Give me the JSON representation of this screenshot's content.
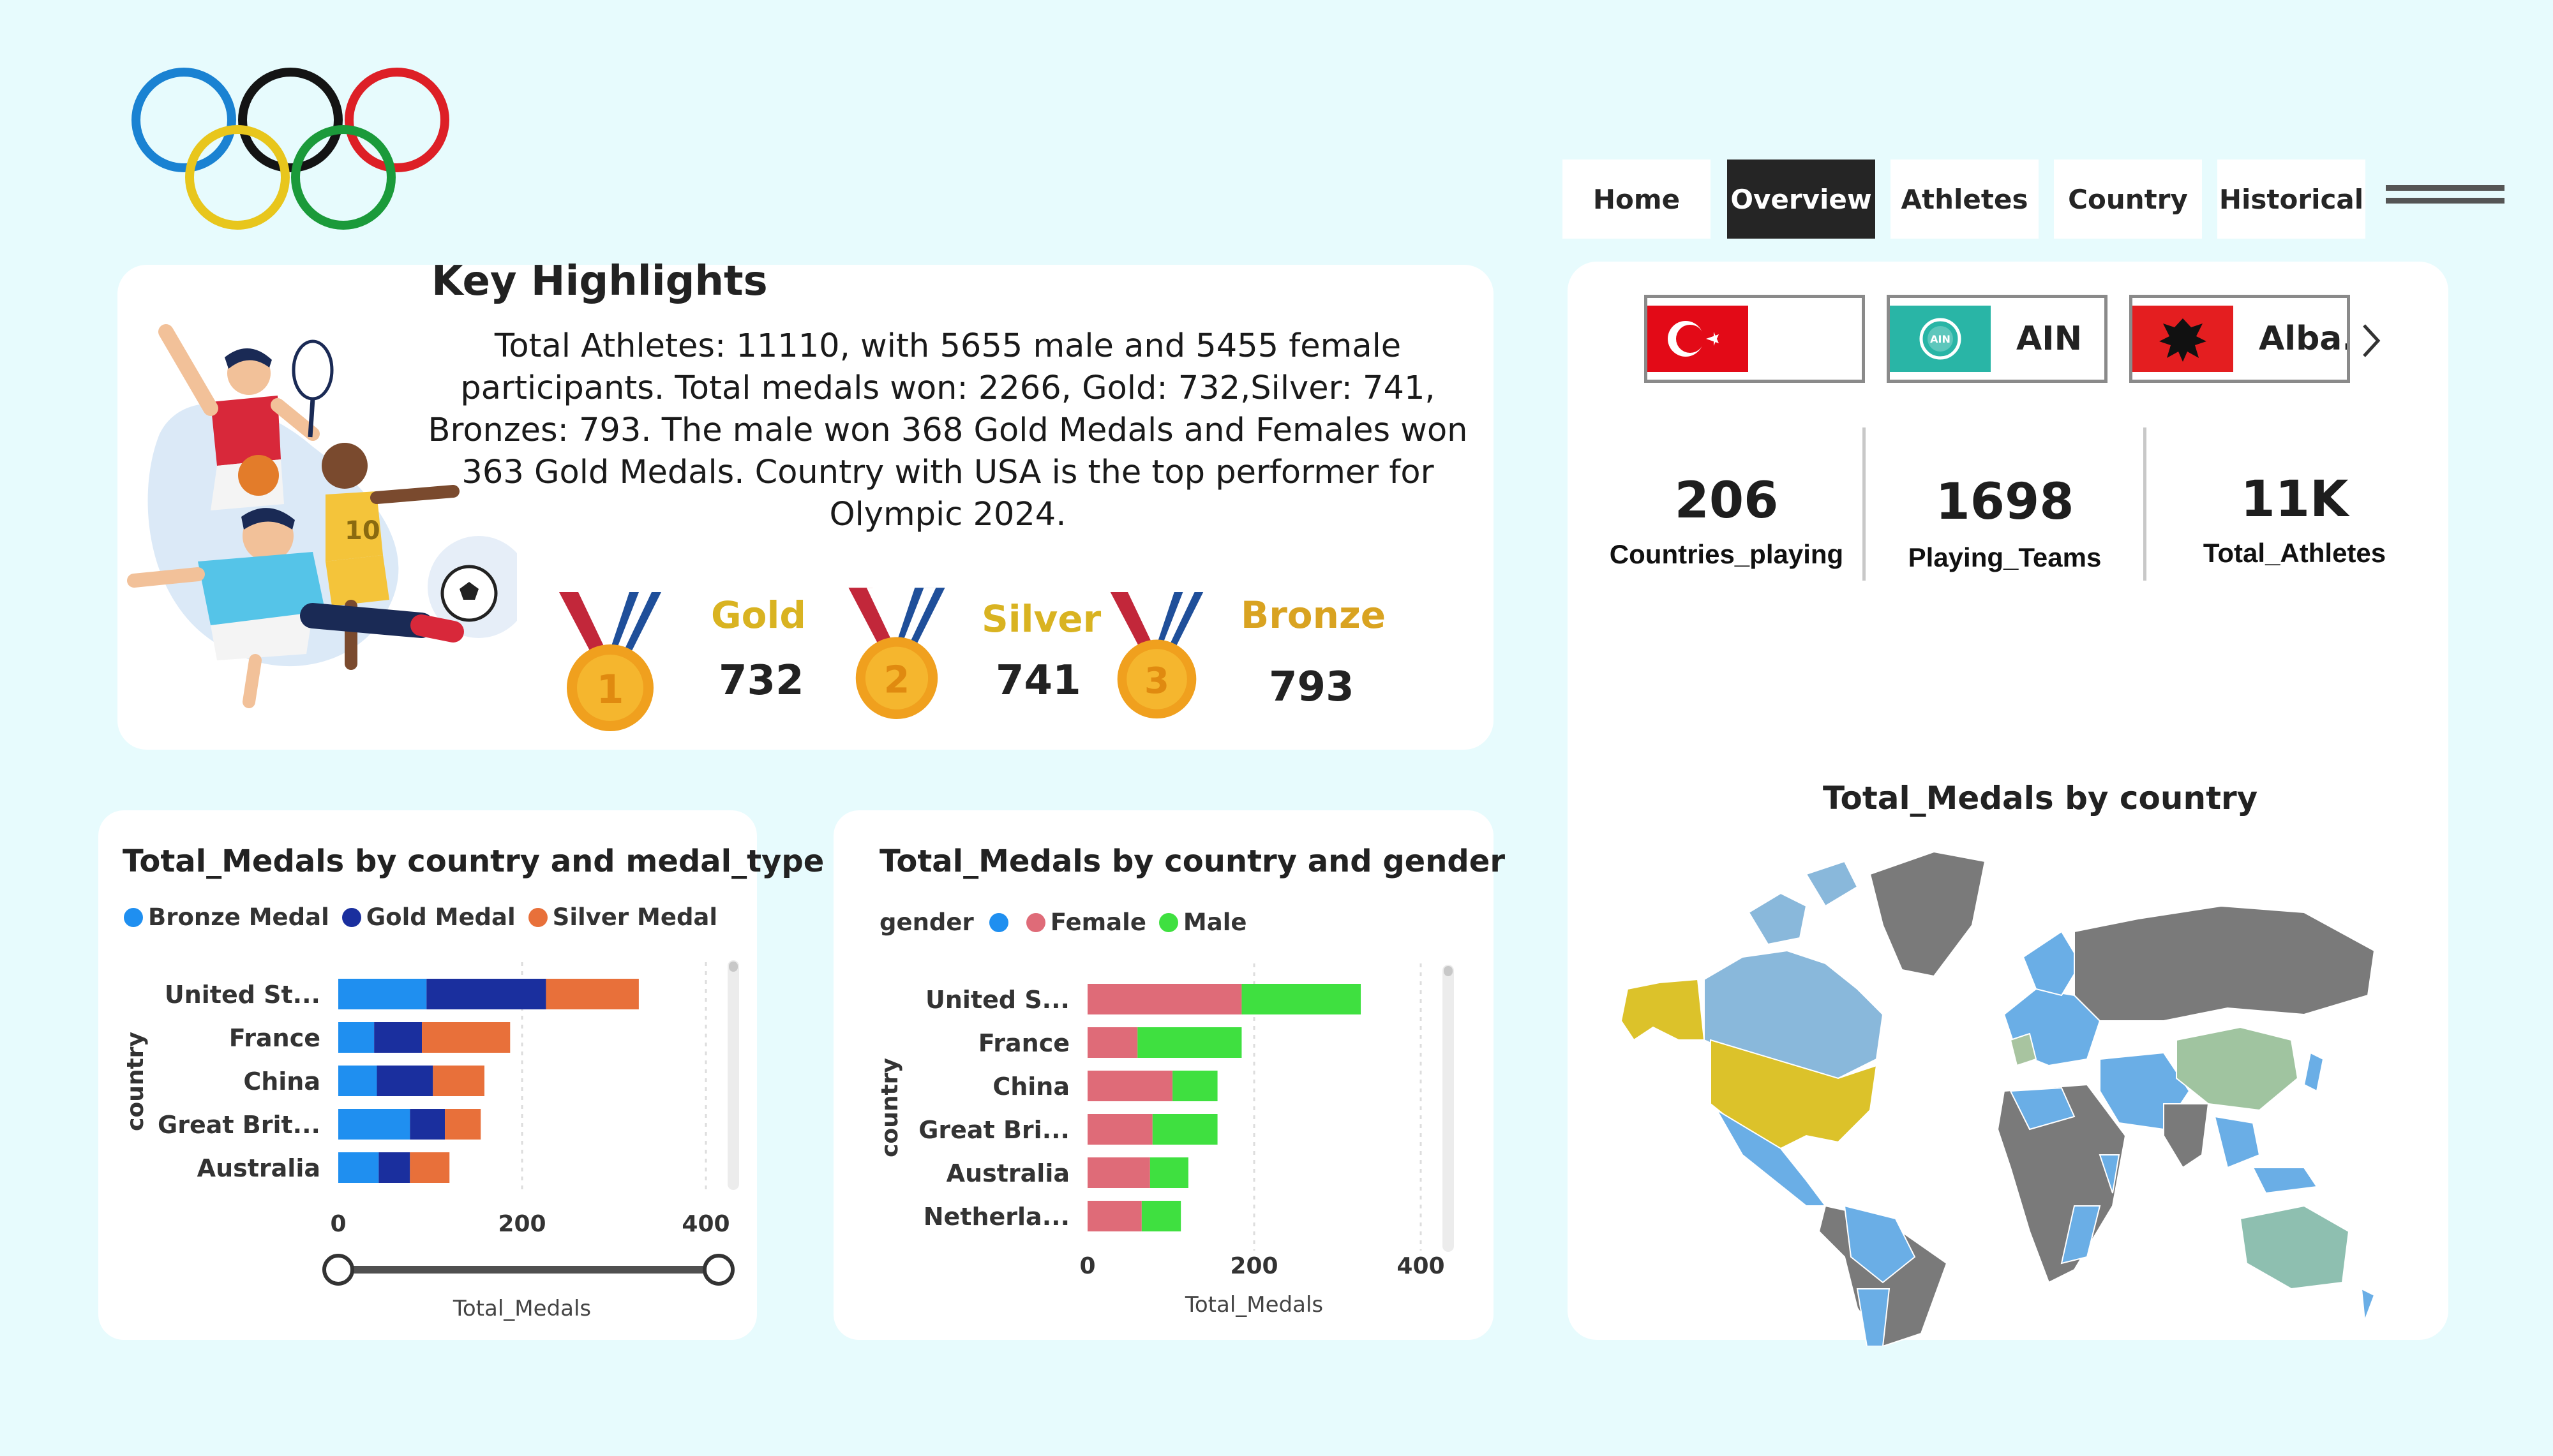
{
  "nav": {
    "items": [
      "Home",
      "Overview",
      "Athletes",
      "Country",
      "Historical"
    ],
    "active": "Overview"
  },
  "key_highlights": {
    "title": "Key Highlights",
    "text": "Total Athletes: 11110, with 5655 male and 5455 female participants. Total medals won: 2266, Gold: 732,Silver: 741, Bronzes: 793. The male won 368 Gold Medals and Females won 363 Gold Medals. Country with USA is the top performer for Olympic 2024.",
    "medals": [
      {
        "label": "Gold",
        "value": "732",
        "medal_number": "1",
        "color": "#d9b321"
      },
      {
        "label": "Silver",
        "value": "741",
        "medal_number": "2",
        "color": "#d9b321"
      },
      {
        "label": "Bronze",
        "value": "793",
        "medal_number": "3",
        "color": "#d9a321"
      }
    ]
  },
  "country_tiles": [
    {
      "name": "",
      "flag": "turkey-flag"
    },
    {
      "name": "AIN",
      "flag": "ain-flag"
    },
    {
      "name": "Alba...",
      "flag": "albania-flag"
    }
  ],
  "kpis": [
    {
      "value": "206",
      "label": "Countries_playing"
    },
    {
      "value": "1698",
      "label": "Playing_Teams"
    },
    {
      "value": "11K",
      "label": "Total_Athletes"
    }
  ],
  "map": {
    "title": "Total_Medals by country"
  },
  "colors": {
    "bronze_medal": "#1f8ff0",
    "gold_medal": "#1a2f9e",
    "silver_medal": "#e8703a",
    "female": "#df6b78",
    "male": "#3fe040",
    "gender_blank": "#1f8ff0",
    "nav_active": "#252525",
    "background": "#e7fbfd"
  },
  "chart_data": [
    {
      "type": "bar",
      "orientation": "horizontal",
      "stacked": true,
      "title": "Total_Medals by country and medal_type",
      "xlabel": "Total_Medals",
      "ylabel": "country",
      "categories": [
        "United St...",
        "France",
        "China",
        "Great Brit...",
        "Australia"
      ],
      "series": [
        {
          "name": "Bronze Medal",
          "values": [
            96,
            39,
            42,
            78,
            44
          ],
          "color": "#1f8ff0"
        },
        {
          "name": "Gold Medal",
          "values": [
            130,
            52,
            61,
            38,
            34
          ],
          "color": "#1a2f9e"
        },
        {
          "name": "Silver Medal",
          "values": [
            101,
            96,
            56,
            39,
            43
          ],
          "color": "#e8703a"
        }
      ],
      "xlim": [
        0,
        400
      ],
      "xticks": [
        "0",
        "200",
        "400"
      ],
      "legend_position": "top-left"
    },
    {
      "type": "bar",
      "orientation": "horizontal",
      "stacked": true,
      "title": "Total_Medals by country and gender",
      "xlabel": "Total_Medals",
      "ylabel": "country",
      "legend_title": "gender",
      "categories": [
        "United S...",
        "France",
        "China",
        "Great Bri...",
        "Australia",
        "Netherla..."
      ],
      "series": [
        {
          "name": "",
          "values": [
            0,
            0,
            0,
            0,
            0,
            0
          ],
          "color": "#1f8ff0"
        },
        {
          "name": "Female",
          "values": [
            185,
            60,
            102,
            78,
            75,
            65
          ],
          "color": "#df6b78"
        },
        {
          "name": "Male",
          "values": [
            143,
            125,
            54,
            78,
            46,
            47
          ],
          "color": "#3fe040"
        }
      ],
      "xlim": [
        0,
        400
      ],
      "xticks": [
        "0",
        "200",
        "400"
      ],
      "legend_position": "top-left"
    }
  ]
}
